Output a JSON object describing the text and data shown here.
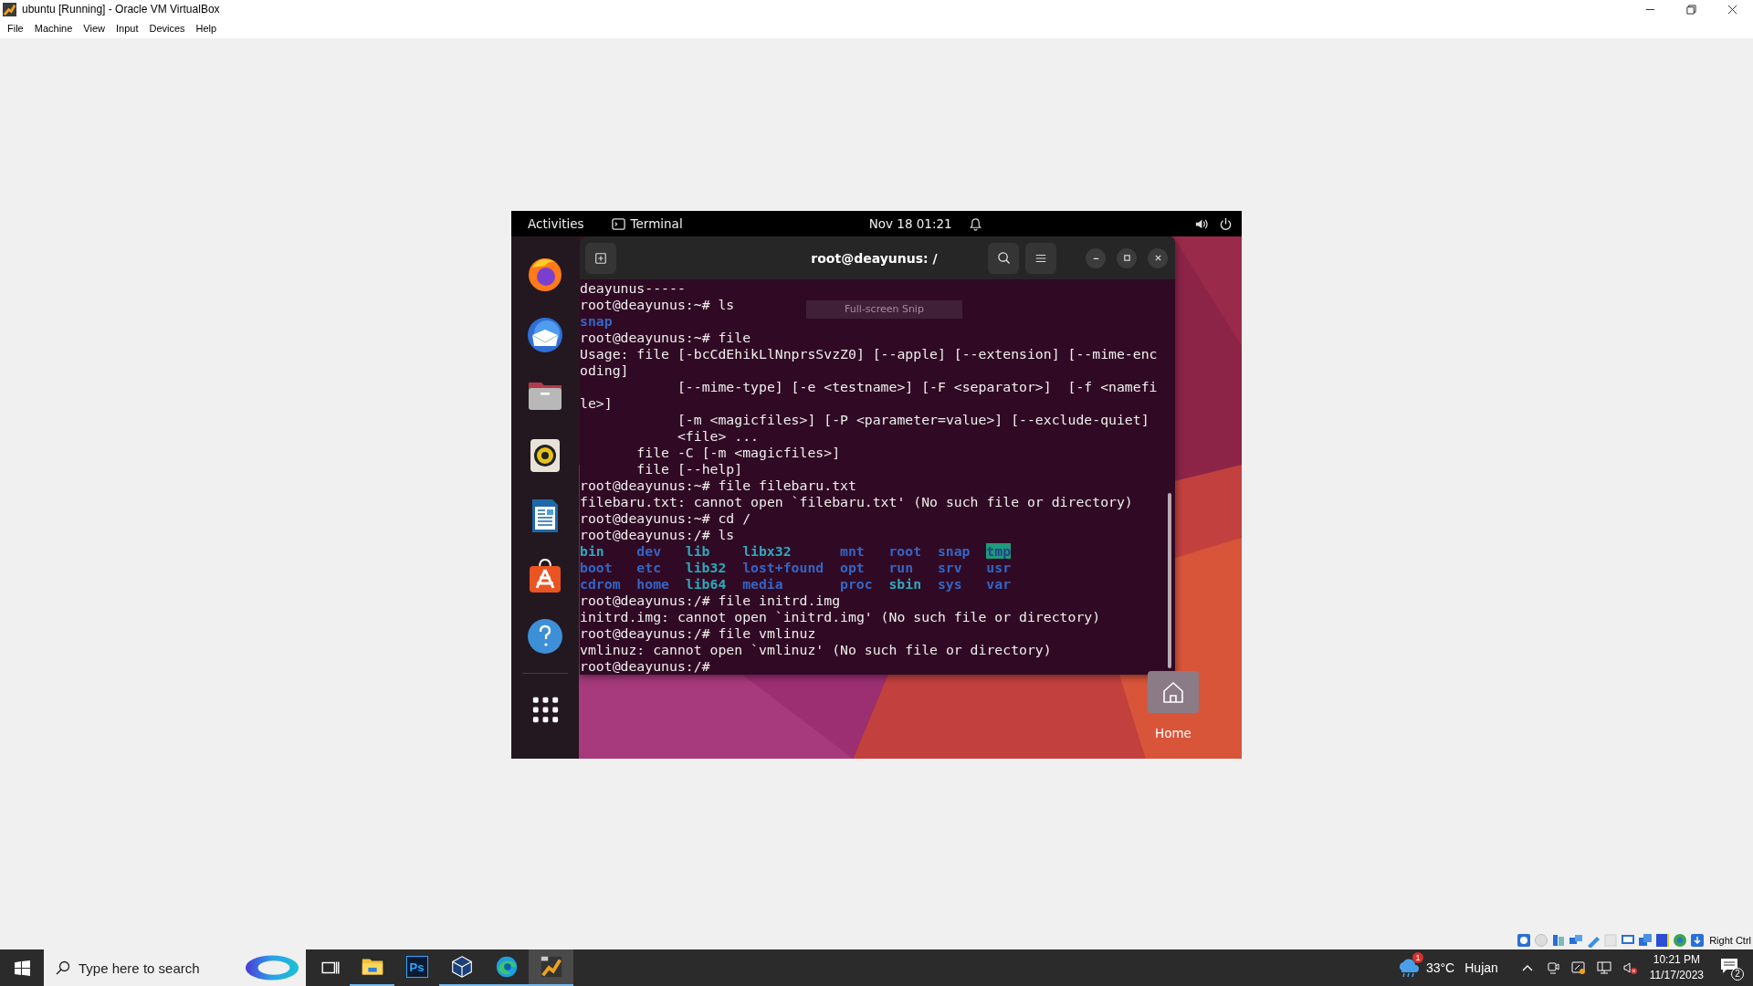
{
  "window": {
    "title": "ubuntu [Running] - Oracle VM VirtualBox"
  },
  "menu": [
    "File",
    "Machine",
    "View",
    "Input",
    "Devices",
    "Help"
  ],
  "guest": {
    "top_bar": {
      "activities": "Activities",
      "app": "Terminal",
      "clock": "Nov 18  01:21"
    },
    "dock": [
      {
        "kind": "browser"
      },
      {
        "kind": "mail"
      },
      {
        "kind": "files"
      },
      {
        "kind": "music"
      },
      {
        "kind": "writer"
      },
      {
        "kind": "store"
      },
      {
        "kind": "help"
      }
    ],
    "terminal": {
      "title": "root@deayunus: /",
      "snip_tooltip": "Full-screen Snip",
      "lines": [
        {
          "kind": "text",
          "text": "deayunus-----"
        },
        {
          "kind": "text",
          "text": "root@deayunus:~# ls"
        },
        {
          "kind": "ls",
          "rows": [
            [
              {
                "name": "snap",
                "kind": "dir"
              }
            ]
          ]
        },
        {
          "kind": "text",
          "text": "root@deayunus:~# file"
        },
        {
          "kind": "text",
          "text": "Usage: file [-bcCdEhikLlNnprsSvzZ0] [--apple] [--extension] [--mime-enc"
        },
        {
          "kind": "text",
          "text": "oding]"
        },
        {
          "kind": "text",
          "text": "            [--mime-type] [-e <testname>] [-F <separator>]  [-f <namefi"
        },
        {
          "kind": "text",
          "text": "le>]"
        },
        {
          "kind": "text",
          "text": "            [-m <magicfiles>] [-P <parameter=value>] [--exclude-quiet]"
        },
        {
          "kind": "text",
          "text": "            <file> ..."
        },
        {
          "kind": "text",
          "text": "       file -C [-m <magicfiles>]"
        },
        {
          "kind": "text",
          "text": "       file [--help]"
        },
        {
          "kind": "text",
          "text": "root@deayunus:~# file filebaru.txt"
        },
        {
          "kind": "text",
          "text": "filebaru.txt: cannot open `filebaru.txt' (No such file or directory)"
        },
        {
          "kind": "text",
          "text": "root@deayunus:~# cd /"
        },
        {
          "kind": "text",
          "text": "root@deayunus:/# ls"
        },
        {
          "kind": "ls",
          "rows": [
            [
              {
                "name": "bin",
                "kind": "link"
              },
              {
                "name": "dev",
                "kind": "dir"
              },
              {
                "name": "lib",
                "kind": "link"
              },
              {
                "name": "libx32",
                "kind": "link"
              },
              {
                "name": "mnt",
                "kind": "dir"
              },
              {
                "name": "root",
                "kind": "dir"
              },
              {
                "name": "snap",
                "kind": "dir"
              },
              {
                "name": "tmp",
                "kind": "sticky"
              }
            ],
            [
              {
                "name": "boot",
                "kind": "dir"
              },
              {
                "name": "etc",
                "kind": "dir"
              },
              {
                "name": "lib32",
                "kind": "link"
              },
              {
                "name": "lost+found",
                "kind": "dir"
              },
              {
                "name": "opt",
                "kind": "dir"
              },
              {
                "name": "run",
                "kind": "dir"
              },
              {
                "name": "srv",
                "kind": "dir"
              },
              {
                "name": "usr",
                "kind": "dir"
              }
            ],
            [
              {
                "name": "cdrom",
                "kind": "dir"
              },
              {
                "name": "home",
                "kind": "dir"
              },
              {
                "name": "lib64",
                "kind": "link"
              },
              {
                "name": "media",
                "kind": "dir"
              },
              {
                "name": "proc",
                "kind": "dir"
              },
              {
                "name": "sbin",
                "kind": "link"
              },
              {
                "name": "sys",
                "kind": "dir"
              },
              {
                "name": "var",
                "kind": "dir"
              }
            ]
          ]
        },
        {
          "kind": "text",
          "text": "root@deayunus:/# file initrd.img"
        },
        {
          "kind": "text",
          "text": "initrd.img: cannot open `initrd.img' (No such file or directory)"
        },
        {
          "kind": "text",
          "text": "root@deayunus:/# file vmlinuz"
        },
        {
          "kind": "text",
          "text": "vmlinuz: cannot open `vmlinuz' (No such file or directory)"
        },
        {
          "kind": "text",
          "text": "root@deayunus:/#"
        }
      ]
    },
    "desktop_icons": [
      {
        "label": "Home"
      }
    ]
  },
  "vbox_status": {
    "host_key": "Right Ctrl"
  },
  "taskbar": {
    "search": {
      "placeholder": "Type here to search"
    },
    "apps": [
      {
        "kind": "explorer",
        "running": true,
        "selected": false
      },
      {
        "kind": "photoshop",
        "label": "Ps",
        "running": false,
        "selected": false
      },
      {
        "kind": "virtualbox",
        "running": true,
        "selected": false
      },
      {
        "kind": "edge",
        "running": true,
        "selected": false
      },
      {
        "kind": "paint",
        "running": true,
        "selected": true
      }
    ],
    "weather": {
      "badge": "1",
      "temperature": "33°C",
      "condition": "Hujan"
    },
    "time": "10:21 PM",
    "date": "11/17/2023",
    "notifications": "2"
  }
}
